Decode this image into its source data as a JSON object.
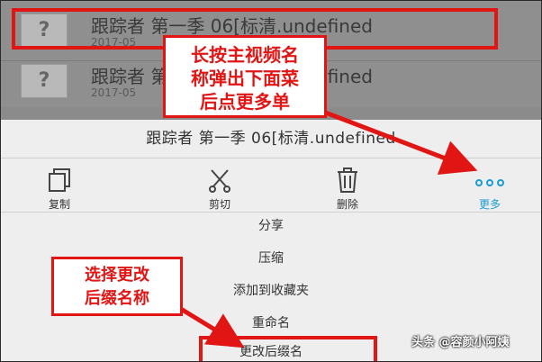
{
  "files": [
    {
      "name": "跟踪者 第一季 06[标清.undefined",
      "date": "2017-05"
    },
    {
      "name": "跟踪者 第一季 06[标清.undefined",
      "date": "2017-05"
    }
  ],
  "thumb_glyph": "?",
  "sheet": {
    "title": "跟踪者 第一季 06[标清.undefined",
    "actions": [
      {
        "label": "复制",
        "icon": "copy-icon"
      },
      {
        "label": "剪切",
        "icon": "scissors-icon"
      },
      {
        "label": "删除",
        "icon": "trash-icon"
      },
      {
        "label": "更多",
        "icon": "more-dots-icon"
      }
    ],
    "menu": [
      "分享",
      "压缩",
      "添加到收藏夹",
      "重命名",
      "更改后缀名"
    ]
  },
  "callouts": {
    "top_lines": [
      "长按主视频名",
      "称弹出下面菜",
      "后点更多单"
    ],
    "bottom_lines": [
      "选择更改",
      "后缀名称"
    ]
  },
  "watermark": "头条 @容颜小阿姨",
  "colors": {
    "annotation_red": "#e21515",
    "accent_blue": "#1a9bd6",
    "sheet_bg": "#eeeeee",
    "dim_bg": "#8f8f8f"
  }
}
